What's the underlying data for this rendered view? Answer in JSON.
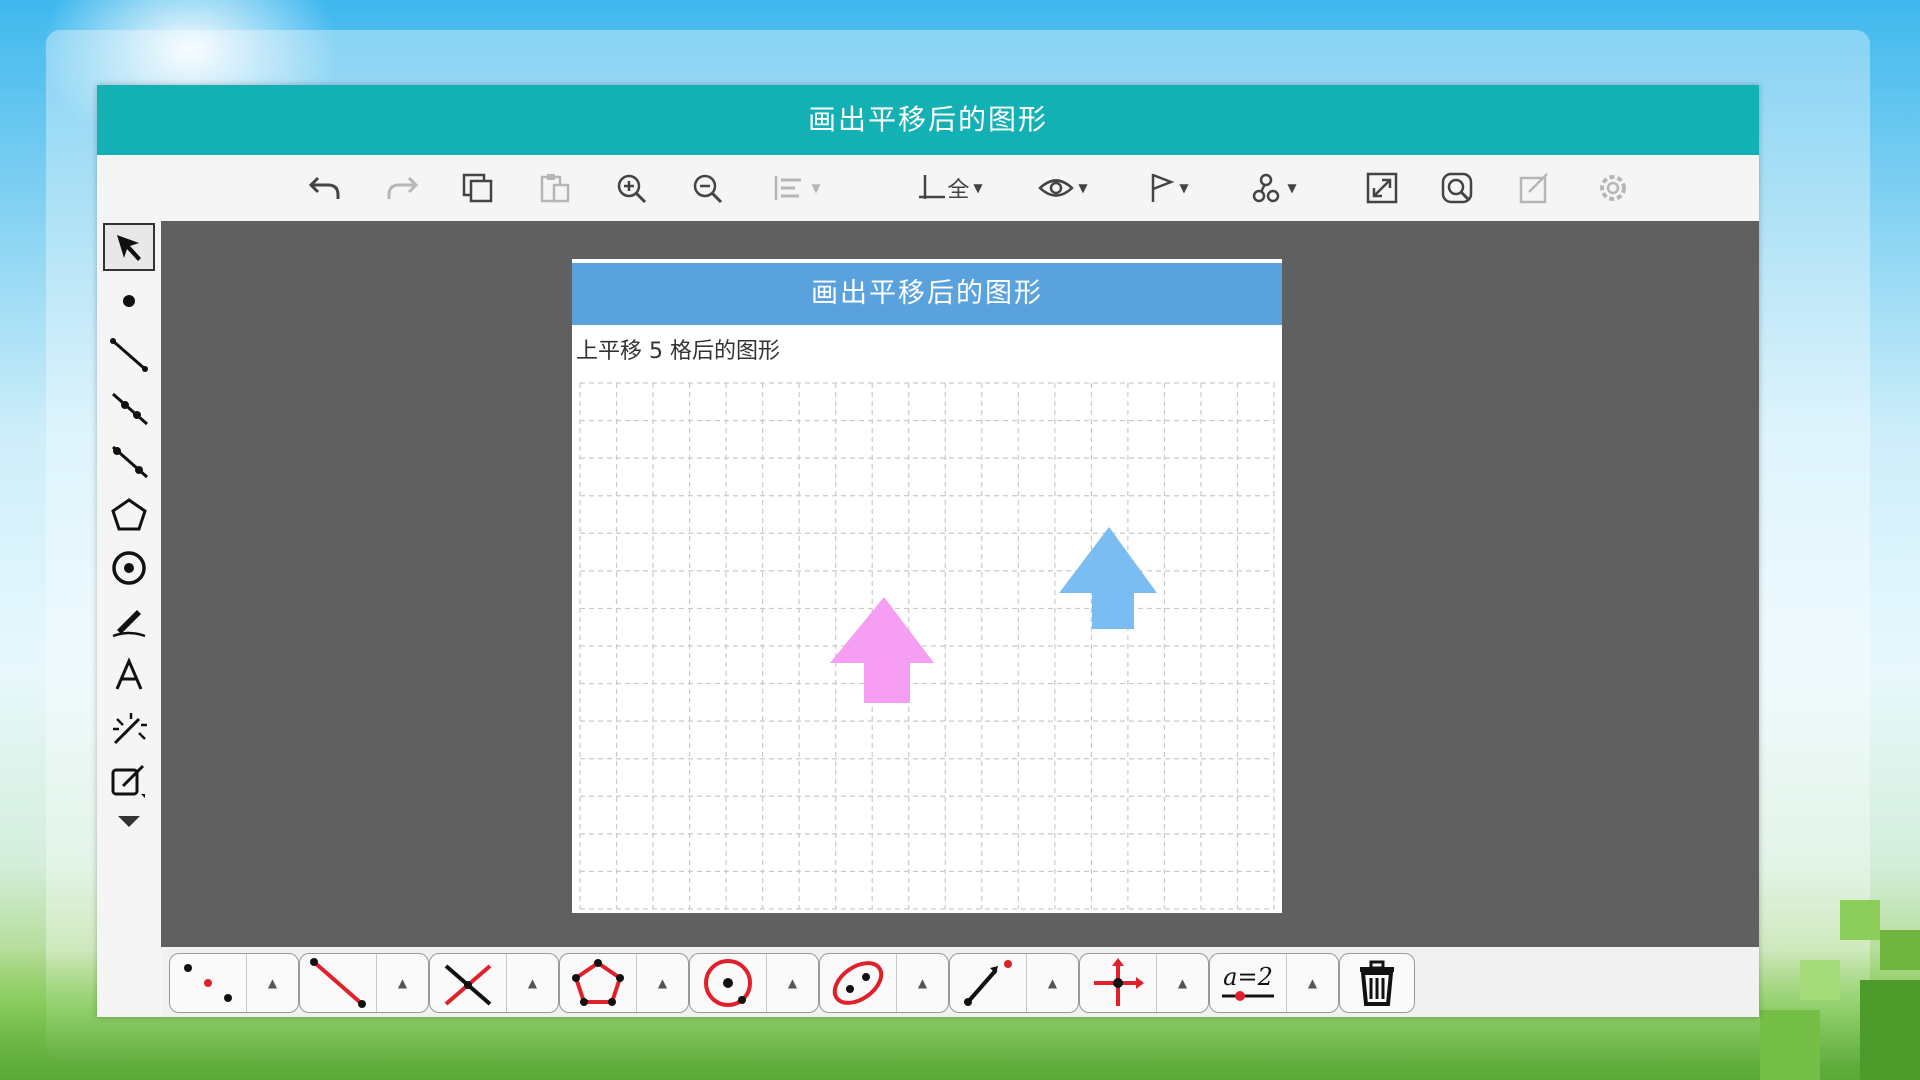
{
  "window": {
    "title": "画出平移后的图形"
  },
  "sheet": {
    "title": "画出平移后的图形",
    "instruction": "上平移 5 格后的图形"
  },
  "toolbar": {
    "icons": [
      "undo-icon",
      "redo-icon",
      "copy-icon",
      "paste-icon",
      "zoom-in-icon",
      "zoom-out-icon",
      "align-icon",
      "axes-icon",
      "eye-icon",
      "flag-icon",
      "style-icon",
      "fullscreen-icon",
      "search-icon",
      "edit-icon",
      "settings-icon"
    ],
    "axes_label": "全"
  },
  "sidebar": {
    "tools": [
      "pointer-icon",
      "point-icon",
      "segment-icon",
      "ray-icon",
      "line-icon",
      "polygon-icon",
      "circle-icon",
      "pen-icon",
      "text-icon",
      "magic-icon",
      "edit-note-icon",
      "more-icon"
    ]
  },
  "bottombar": {
    "groups": [
      "points-tool",
      "segment-tool",
      "intersect-tool",
      "polygon-tool",
      "circle-tool",
      "conic-tool",
      "vector-tool",
      "transform-tool",
      "slider-tool"
    ],
    "slider_label": "a=2",
    "trash": "trash-icon"
  },
  "colors": {
    "titlebar": "#13b0b4",
    "sheet_header": "#5aa2de",
    "canvas_bg": "#606060",
    "arrow_pink": "#f59ef3",
    "arrow_blue": "#79bdf2"
  },
  "shapes": {
    "arrow_pink": "pink-arrow",
    "arrow_blue": "blue-arrow"
  }
}
